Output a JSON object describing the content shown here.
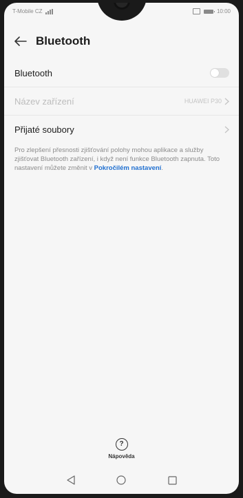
{
  "status_bar": {
    "carrier": "T-Mobile CZ",
    "time": "10:00"
  },
  "header": {
    "title": "Bluetooth",
    "back_icon": "arrow-left-icon"
  },
  "settings": {
    "bluetooth": {
      "label": "Bluetooth",
      "enabled": false
    },
    "device_name": {
      "label": "Název zařízení",
      "value": "HUAWEI P30"
    },
    "received_files": {
      "label": "Přijaté soubory"
    }
  },
  "info": {
    "text": "Pro zlepšení přesnosti zjišťování polohy mohou aplikace a služby zjišťovat Bluetooth zařízení, i když není funkce Bluetooth zapnuta. Toto nastavení můžete změnit v ",
    "link": "Pokročilém nastavení",
    "suffix": "."
  },
  "help": {
    "label": "Nápověda",
    "icon": "help-circle-icon"
  },
  "nav_bar": {
    "back_icon": "triangle-back-icon",
    "home_icon": "circle-home-icon",
    "recents_icon": "square-recents-icon"
  },
  "colors": {
    "accent": "#1f6fd0",
    "background": "#f6f6f6"
  }
}
